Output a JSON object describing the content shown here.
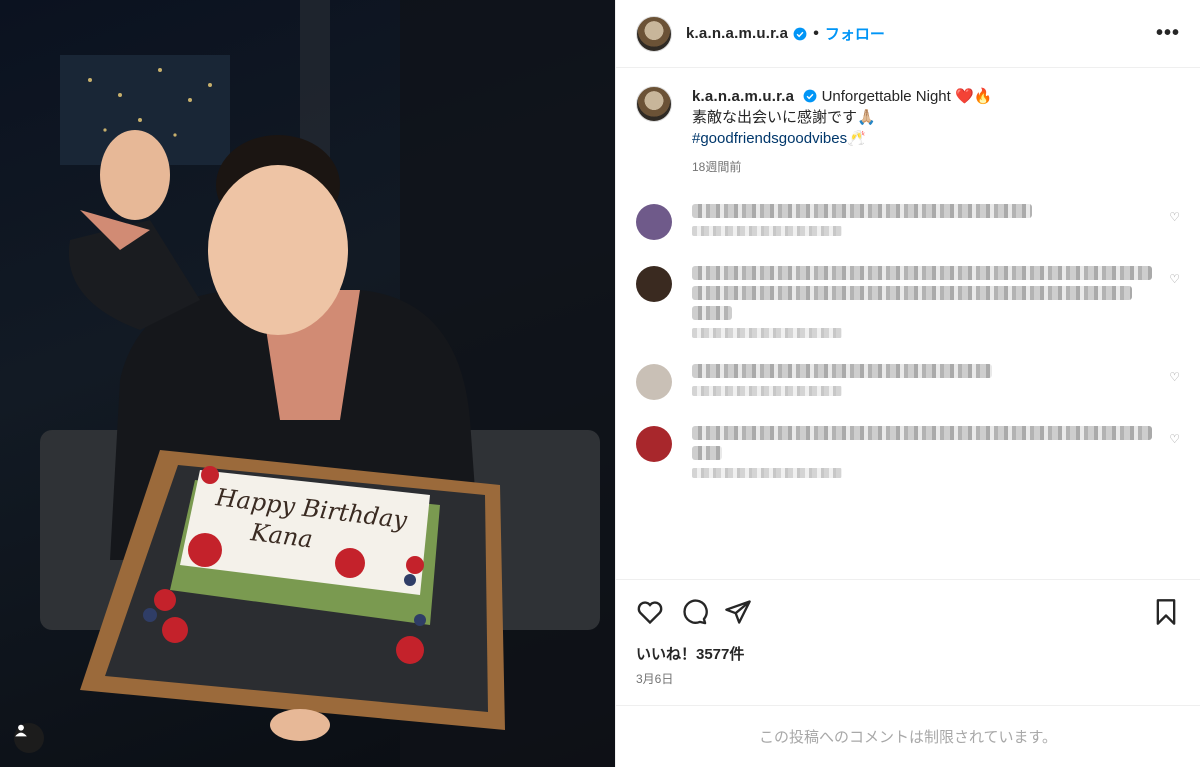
{
  "post": {
    "username": "k.a.n.a.m.u.r.a",
    "follow_label": "フォロー",
    "separator": "•",
    "more_label": "•••",
    "caption": {
      "title": "Unforgettable Night",
      "title_emoji": "❤️🔥",
      "line2": "素敵な出会いに感謝です🙏🏼",
      "hashtag": "#goodfriendsgoodvibes",
      "hashtag_emoji": "🥂",
      "time_ago": "18週間前"
    },
    "likes": "いいね！3577件",
    "date": "3月6日",
    "comments_restricted": "この投稿へのコメントは制限されています。",
    "cake_text": {
      "line1": "Happy Birthday",
      "line2": "Kana"
    }
  },
  "icons": {
    "verified": "verified-badge-icon",
    "like": "heart-icon",
    "comment": "comment-bubble-icon",
    "share": "paper-plane-icon",
    "save": "bookmark-icon",
    "tag": "user-tag-icon"
  },
  "colors": {
    "accent": "#0095f6",
    "verified": "#0095f6",
    "hashtag": "#00376b",
    "muted": "#737373"
  }
}
